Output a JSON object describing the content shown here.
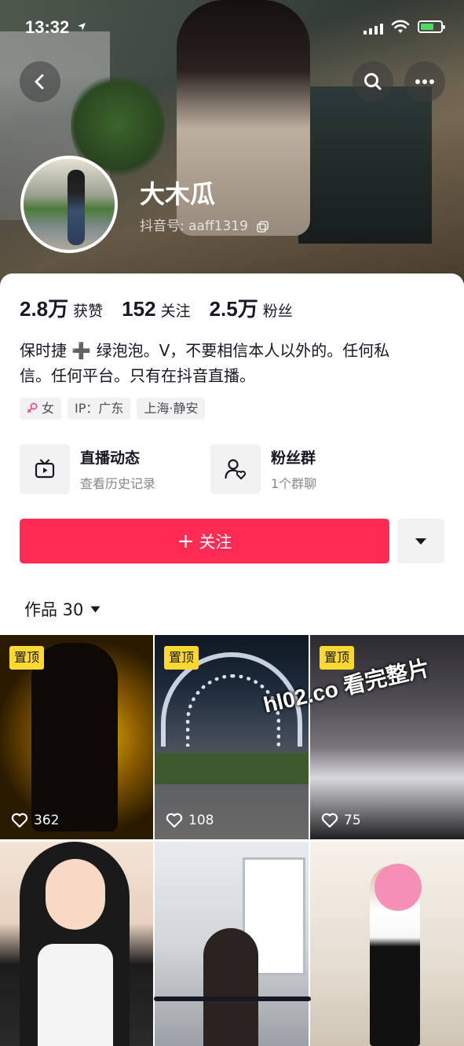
{
  "status_bar": {
    "time": "13:32"
  },
  "profile": {
    "nickname": "大木瓜",
    "douyin_id": "抖音号: aaff1319",
    "stats": [
      {
        "value": "2.8万",
        "label": "获赞"
      },
      {
        "value": "152",
        "label": "关注"
      },
      {
        "value": "2.5万",
        "label": "粉丝"
      }
    ],
    "bio_line1": "保时捷 ➕ 绿泡泡。V，不要相信本人以外的。任何私",
    "bio_line2": "信。任何平台。只有在抖音直播。",
    "tags": {
      "gender": "女",
      "ip": "IP：广东",
      "location": "上海·静安"
    }
  },
  "features": {
    "live": {
      "title": "直播动态",
      "subtitle": "查看历史记录"
    },
    "fans": {
      "title": "粉丝群",
      "subtitle": "1个群聊"
    }
  },
  "follow_button": {
    "plus": "+",
    "label": "关注"
  },
  "works_tab": {
    "label": "作品 30"
  },
  "videos": [
    {
      "pinned": "置顶",
      "likes": "362"
    },
    {
      "pinned": "置顶",
      "likes": "108"
    },
    {
      "pinned": "置顶",
      "likes": "75"
    },
    {},
    {},
    {}
  ],
  "watermark": "hl02.co 看完整片",
  "colors": {
    "accent": "#fe2c55",
    "pin_badge": "#fcd830",
    "battery": "#4cd964"
  },
  "icons": [
    "location-arrow-icon",
    "signal-icon",
    "wifi-icon",
    "battery-icon",
    "back-icon",
    "search-icon",
    "more-icon",
    "copy-icon",
    "female-icon",
    "tv-icon",
    "fan-group-icon",
    "dropdown-arrow-icon",
    "caret-down-icon",
    "heart-icon"
  ]
}
